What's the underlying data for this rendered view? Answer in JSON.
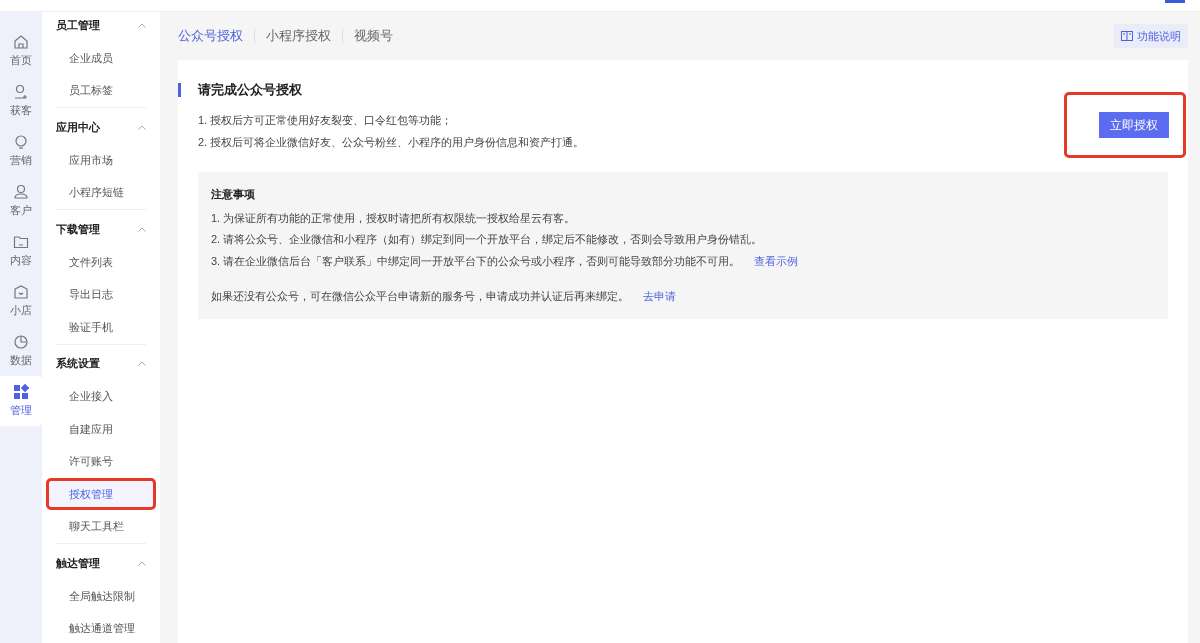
{
  "rail": [
    {
      "label": "首页",
      "selected": false
    },
    {
      "label": "获客",
      "selected": false
    },
    {
      "label": "营销",
      "selected": false
    },
    {
      "label": "客户",
      "selected": false
    },
    {
      "label": "内容",
      "selected": false
    },
    {
      "label": "小店",
      "selected": false
    },
    {
      "label": "数据",
      "selected": false
    },
    {
      "label": "管理",
      "selected": true
    }
  ],
  "menu": [
    {
      "title": "员工管理",
      "expanded": true,
      "items": [
        {
          "label": "企业成员",
          "selected": false,
          "annotated": false
        },
        {
          "label": "员工标签",
          "selected": false,
          "annotated": false
        }
      ]
    },
    {
      "title": "应用中心",
      "expanded": true,
      "items": [
        {
          "label": "应用市场",
          "selected": false,
          "annotated": false
        },
        {
          "label": "小程序短链",
          "selected": false,
          "annotated": false
        }
      ]
    },
    {
      "title": "下载管理",
      "expanded": true,
      "items": [
        {
          "label": "文件列表",
          "selected": false,
          "annotated": false
        },
        {
          "label": "导出日志",
          "selected": false,
          "annotated": false
        },
        {
          "label": "验证手机",
          "selected": false,
          "annotated": false
        }
      ]
    },
    {
      "title": "系统设置",
      "expanded": true,
      "items": [
        {
          "label": "企业接入",
          "selected": false,
          "annotated": false
        },
        {
          "label": "自建应用",
          "selected": false,
          "annotated": false
        },
        {
          "label": "许可账号",
          "selected": false,
          "annotated": false
        },
        {
          "label": "授权管理",
          "selected": true,
          "annotated": true
        },
        {
          "label": "聊天工具栏",
          "selected": false,
          "annotated": false
        }
      ]
    },
    {
      "title": "触达管理",
      "expanded": true,
      "items": [
        {
          "label": "全局触达限制",
          "selected": false,
          "annotated": false
        },
        {
          "label": "触达通道管理",
          "selected": false,
          "annotated": false
        }
      ]
    }
  ],
  "tabs": [
    {
      "label": "公众号授权",
      "selected": true
    },
    {
      "label": "小程序授权",
      "selected": false
    },
    {
      "label": "视频号",
      "selected": false
    }
  ],
  "help_button": "功能说明",
  "section": {
    "title": "请完成公众号授权",
    "lines": [
      "1. 授权后方可正常使用好友裂变、口令红包等功能；",
      "2. 授权后可将企业微信好友、公众号粉丝、小程序的用户身份信息和资产打通。"
    ],
    "button": {
      "label": "立即授权",
      "annotated": true
    }
  },
  "notice": {
    "title": "注意事项",
    "lines": [
      {
        "text": "1. 为保证所有功能的正常使用，授权时请把所有权限统一授权给星云有客。"
      },
      {
        "text": "2. 请将公众号、企业微信和小程序（如有）绑定到同一个开放平台，绑定后不能修改，否则会导致用户身份错乱。"
      },
      {
        "text": "3. 请在企业微信后台「客户联系」中绑定同一开放平台下的公众号或小程序，否则可能导致部分功能不可用。",
        "link": "查看示例"
      }
    ],
    "footer": {
      "text": "如果还没有公众号，可在微信公众平台申请新的服务号，申请成功并认证后再来绑定。",
      "link": "去申请"
    }
  }
}
